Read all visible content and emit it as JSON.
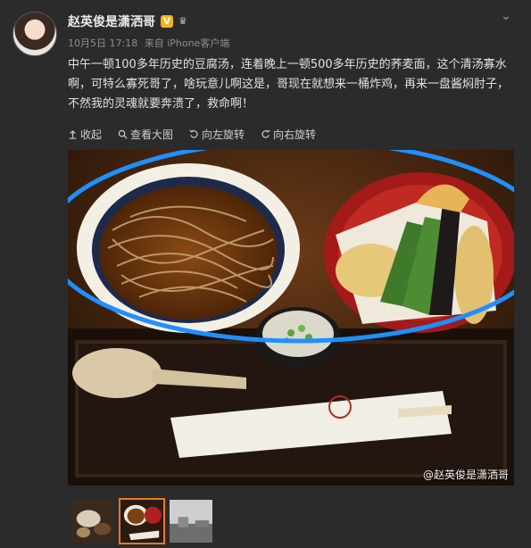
{
  "post": {
    "user_name": "赵英俊是潇洒哥",
    "verified_label": "V",
    "date": "10月5日 17:18",
    "source": "来自 iPhone客户端",
    "text": "中午一顿100多年历史的豆腐汤，连着晚上一顿500多年历史的荞麦面，这个清汤寡水啊，可特么寡死哥了，啥玩意儿啊这是，哥现在就想来一桶炸鸡，再来一盘酱焖肘子，不然我的灵魂就要奔溃了，救命啊！"
  },
  "toolbar": {
    "collapse": "收起",
    "view_large": "查看大图",
    "rotate_left": "向左旋转",
    "rotate_right": "向右旋转"
  },
  "image": {
    "watermark": "@赵英俊是潇洒哥"
  },
  "colors": {
    "background": "#2b2b2b",
    "accent": "#f27a1a",
    "annotation": "#1e90ff"
  },
  "thumbnails": [
    {
      "name": "thumb-1",
      "active": false
    },
    {
      "name": "thumb-2",
      "active": true
    },
    {
      "name": "thumb-3",
      "active": false
    }
  ]
}
